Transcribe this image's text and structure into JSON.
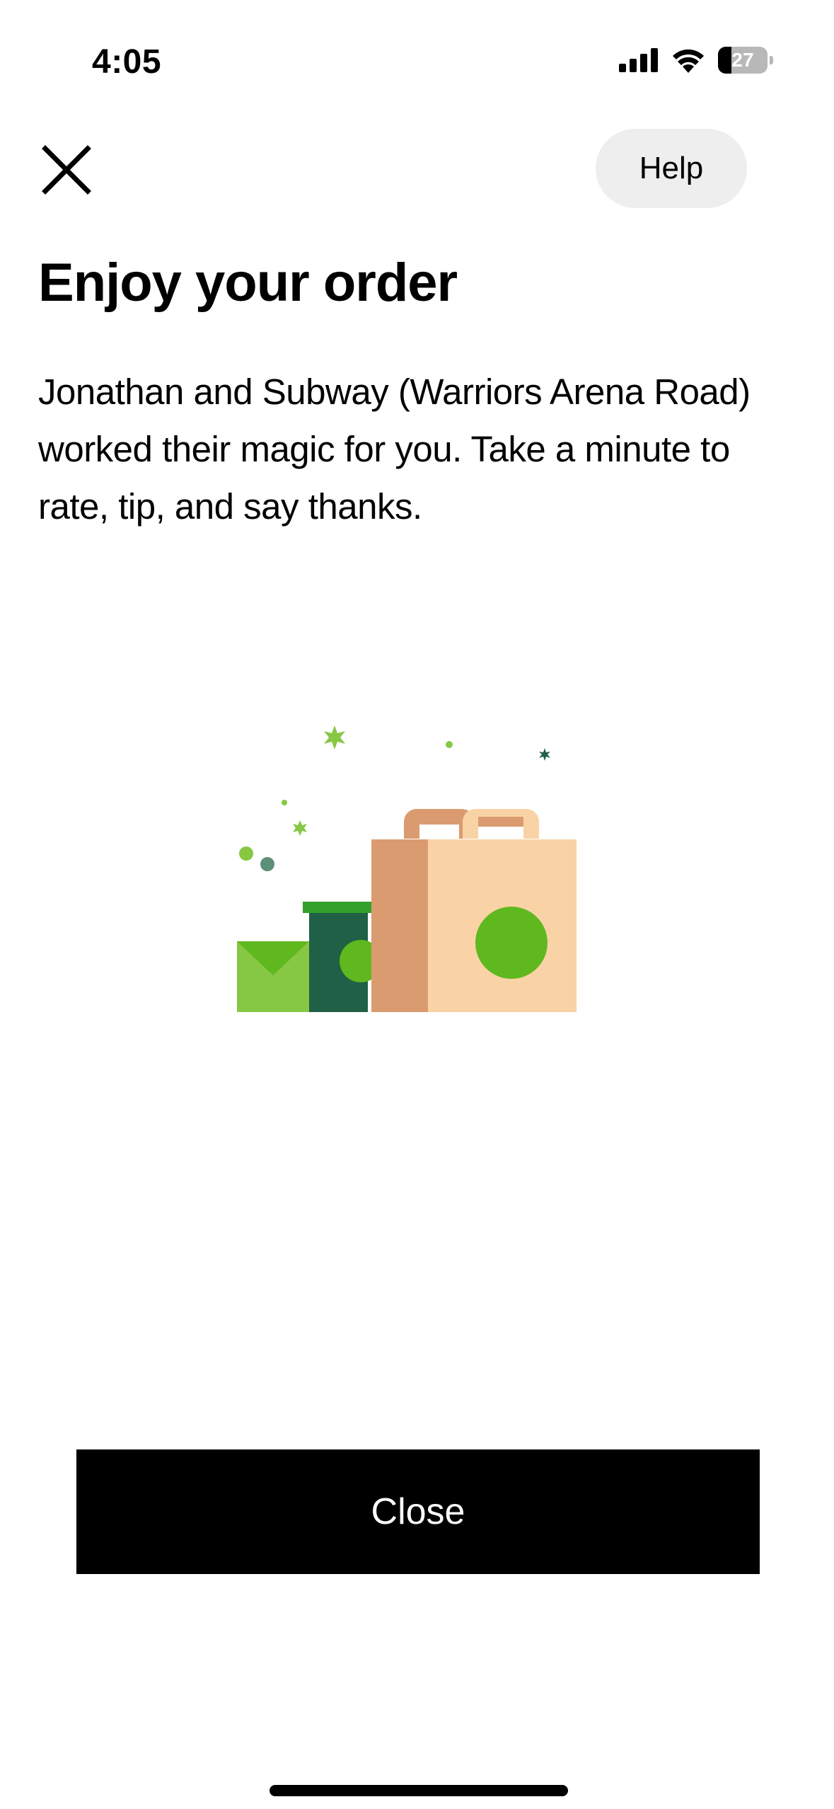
{
  "status_bar": {
    "time": "4:05",
    "battery_level": "27",
    "battery_fraction": 0.27,
    "icons": [
      "cellular-signal-icon",
      "wifi-icon",
      "battery-icon"
    ]
  },
  "header": {
    "close_icon": "close-icon",
    "help_label": "Help"
  },
  "main": {
    "title": "Enjoy your order",
    "message": "Jonathan and Subway (Warriors Arena Road) worked their magic for you. Take a minute to rate, tip, and say thanks.",
    "illustration": "order-bags-illustration"
  },
  "footer": {
    "close_label": "Close"
  },
  "colors": {
    "primary_button": "#000000",
    "help_pill": "#eeeeee",
    "bag_light": "#f9d3a6",
    "bag_dark": "#db9b70",
    "green_bright": "#5fb81e",
    "green_light": "#86c744",
    "green_dark": "#1f6046"
  }
}
